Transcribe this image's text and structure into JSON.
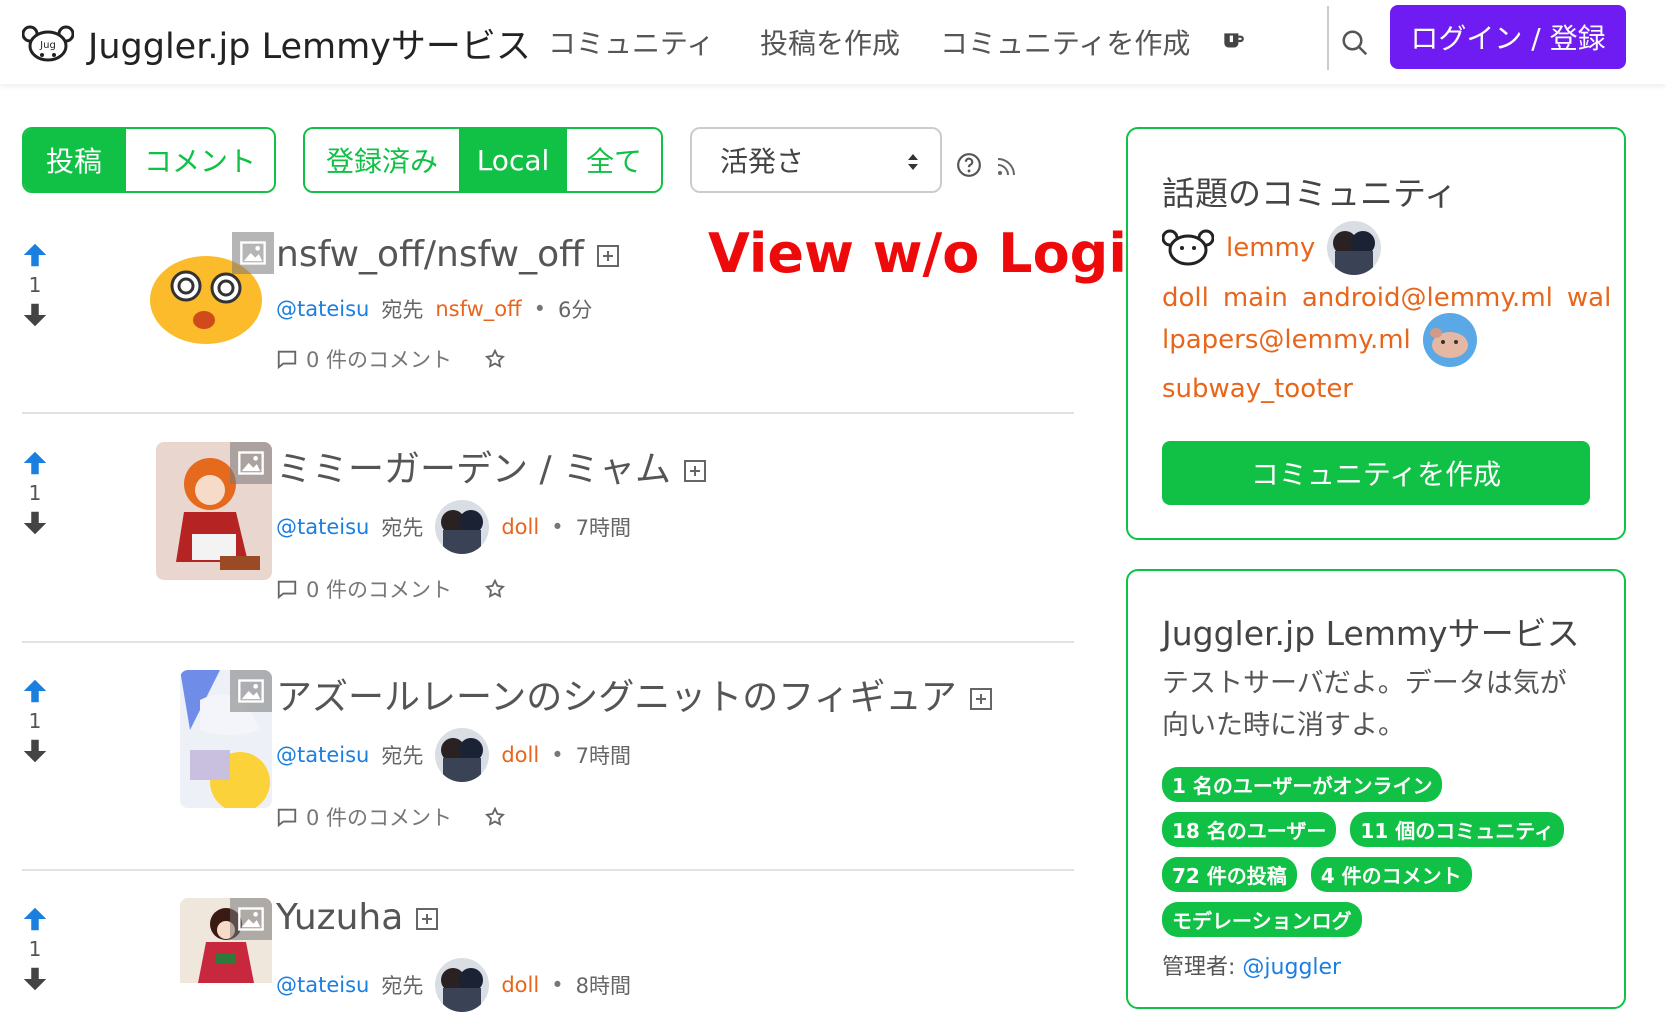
{
  "header": {
    "site_name": "Juggler.jp Lemmyサービス",
    "nav": [
      "コミュニティ",
      "投稿を作成",
      "コミュニティを作成"
    ],
    "login_label": "ログイン / 登録"
  },
  "toolbar": {
    "type_tabs": [
      {
        "label": "投稿",
        "active": true
      },
      {
        "label": "コメント",
        "active": false
      }
    ],
    "listing_tabs": [
      {
        "label": "登録済み",
        "active": false
      },
      {
        "label": "Local",
        "active": true
      },
      {
        "label": "全て",
        "active": false
      }
    ],
    "sort_value": "活発さ"
  },
  "overlay_text": "View w/o Login",
  "posts": [
    {
      "score": "1",
      "title": "nsfw_off/nsfw_off",
      "user": "@tateisu",
      "to": "宛先",
      "community": "nsfw_off",
      "time": "6分",
      "comments": "0 件のコメント"
    },
    {
      "score": "1",
      "title": "ミミーガーデン / ミャム",
      "user": "@tateisu",
      "to": "宛先",
      "community": "doll",
      "time": "7時間",
      "comments": "0 件のコメント"
    },
    {
      "score": "1",
      "title": "アズールレーンのシグニットのフィギュア",
      "user": "@tateisu",
      "to": "宛先",
      "community": "doll",
      "time": "7時間",
      "comments": "0 件のコメント"
    },
    {
      "score": "1",
      "title": "Yuzuha",
      "user": "@tateisu",
      "to": "宛先",
      "community": "doll",
      "time": "8時間",
      "comments": "0 件のコメント"
    }
  ],
  "trending": {
    "title": "話題のコミュニティ",
    "items": [
      "lemmy",
      "doll",
      "main",
      "android@lemmy.ml",
      "wal",
      "lpapers@lemmy.ml",
      "subway_tooter"
    ],
    "create_label": "コミュニティを作成"
  },
  "site_info": {
    "title": "Juggler.jp Lemmyサービス",
    "description": "テストサーバだよ。データは気が向いた時に消すよ。",
    "badges": [
      "1 名のユーザーがオンライン",
      "18 名のユーザー",
      "11 個のコミュニティ",
      "72 件の投稿",
      "4 件のコメント",
      "モデレーションログ"
    ],
    "admin_label": "管理者:",
    "admin_user": "@juggler"
  },
  "colors": {
    "accent": "#10c146",
    "login": "#6f1cf2",
    "user_link": "#1b7fe0",
    "community_link": "#e8661b",
    "upvote": "#1b7fe0",
    "overlay": "#ee0a0a"
  }
}
